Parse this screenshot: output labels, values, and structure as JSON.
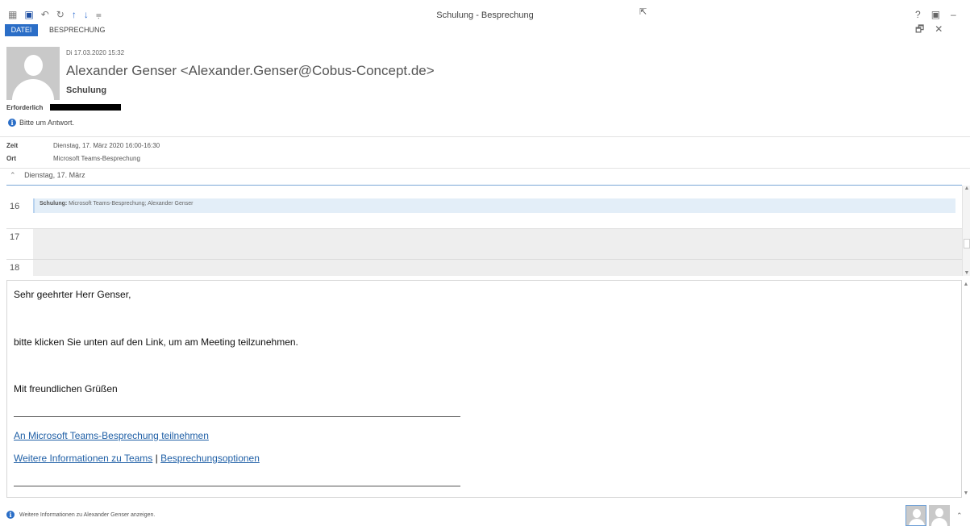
{
  "titlebar": {
    "title": "Schulung - Besprechung",
    "qat_icons": [
      "calendar-icon",
      "save-icon",
      "undo-icon",
      "redo-icon",
      "arrow-up-icon",
      "arrow-down-icon",
      "customize-icon"
    ],
    "help": "?",
    "min": "–",
    "restore": "🗗",
    "close": "✕"
  },
  "ribbon": {
    "tab_file": "DATEI",
    "tab_meeting": "BESPRECHUNG"
  },
  "header": {
    "date": "Di 17.03.2020 15:32",
    "sender": "Alexander Genser <Alexander.Genser@Cobus-Concept.de>",
    "subject": "Schulung",
    "required_label": "Erforderlich",
    "reply_notice": "Bitte um Antwort."
  },
  "details": {
    "time_label": "Zeit",
    "time_value": "Dienstag, 17. März 2020 16:00-16:30",
    "location_label": "Ort",
    "location_value": "Microsoft Teams-Besprechung"
  },
  "calendar": {
    "day_header": "Dienstag, 17. März",
    "hours": [
      "16",
      "17",
      "18"
    ],
    "appointment_title": "Schulung:",
    "appointment_detail": " Microsoft Teams-Besprechung; Alexander Genser"
  },
  "body": {
    "greeting": "Sehr geehrter Herr Genser,",
    "line1": "bitte klicken Sie unten auf den Link, um am Meeting teilzunehmen.",
    "closing": "Mit freundlichen Grüßen",
    "join_link": "An Microsoft Teams-Besprechung teilnehmen",
    "more_info_link": "Weitere Informationen zu Teams",
    "divider": "|",
    "options_link": "Besprechungsoptionen"
  },
  "status": {
    "text": "Weitere Informationen zu Alexander Genser anzeigen."
  },
  "colors": {
    "accent": "#2b6ec7",
    "link": "#1f5fa6",
    "appointment": "#e3eef8"
  }
}
